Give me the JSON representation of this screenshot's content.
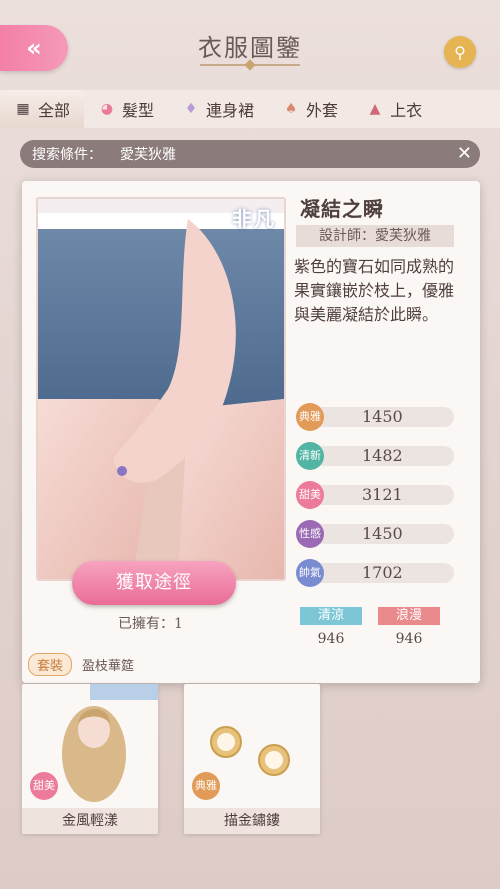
{
  "header": {
    "title": "衣服圖鑒",
    "back_icon": "«"
  },
  "tabs": [
    {
      "label": "全部",
      "icon": "grid-icon"
    },
    {
      "label": "髮型",
      "icon": "hair-icon"
    },
    {
      "label": "連身裙",
      "icon": "dress-icon"
    },
    {
      "label": "外套",
      "icon": "coat-icon"
    },
    {
      "label": "上衣",
      "icon": "top-icon"
    }
  ],
  "filter": {
    "label": "搜索條件：",
    "value": "愛芙狄雅",
    "close": "✕"
  },
  "item": {
    "rarity": "非凡",
    "name": "凝結之瞬",
    "designer": "設計師：愛芙狄雅",
    "description": "紫色的寶石如同成熟的果實鑲嵌於枝上，優雅與美麗凝結於此瞬。",
    "obtain_button": "獲取途徑",
    "owned": "已擁有：1",
    "suit_tag": "套裝",
    "suit_name": "盈枝華筵",
    "stats": [
      {
        "badge": "典雅",
        "value": "1450",
        "color": "#e29a58"
      },
      {
        "badge": "清新",
        "value": "1482",
        "color": "#52b5a3"
      },
      {
        "badge": "甜美",
        "value": "3121",
        "color": "#ec7a9a"
      },
      {
        "badge": "性感",
        "value": "1450",
        "color": "#9b6ab5"
      },
      {
        "badge": "帥氣",
        "value": "1702",
        "color": "#7a8cd0"
      }
    ],
    "tags": [
      {
        "label": "清涼",
        "value": "946",
        "color": "#7cc6d6"
      },
      {
        "label": "浪漫",
        "value": "946",
        "color": "#e98a8c"
      }
    ]
  },
  "cards": [
    {
      "name": "金風輕漾",
      "badge": "甜美",
      "color": "#ec7a9a"
    },
    {
      "name": "描金鏽鏤",
      "badge": "典雅",
      "color": "#e29a58"
    }
  ]
}
